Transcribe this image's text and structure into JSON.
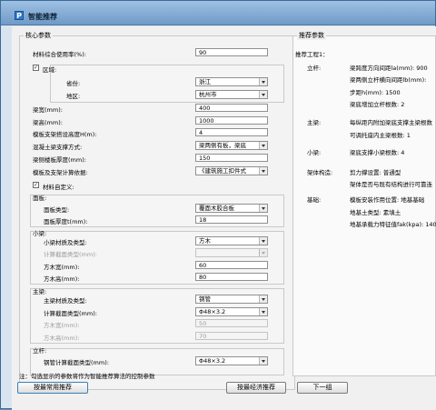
{
  "window": {
    "title": "智能推荐",
    "app_icon": "P"
  },
  "core": {
    "title": "核心参数",
    "material_rate_label": "材料综合使用率(%):",
    "material_rate_value": "90",
    "region_label": "区域:",
    "province_label": "省份:",
    "province_value": "浙江",
    "area_label": "地区:",
    "area_value": "杭州市",
    "beam_width_label": "梁宽(mm):",
    "beam_width_value": "400",
    "beam_height_label": "梁高(mm):",
    "beam_height_value": "1000",
    "support_height_label": "模板支架搭设高度H(m):",
    "support_height_value": "4",
    "concrete_label": "混凝土梁支撑方式:",
    "concrete_value": "梁两侧有板，梁底",
    "slab_label": "梁侧楼板厚度(mm):",
    "slab_value": "150",
    "calc_basis_label": "模板及支架计算依据:",
    "calc_basis_value": "《建筑施工扣件式",
    "custom_label": "材料自定义:"
  },
  "panel": {
    "title": "面板:",
    "type_label": "面板类型:",
    "type_value": "覆面木胶合板",
    "thickness_label": "面板厚度t(mm):",
    "thickness_value": "18"
  },
  "small_beam": {
    "title": "小梁:",
    "material_label": "小梁材质及类型:",
    "material_value": "方木",
    "section_label": "计算截面类型(mm):",
    "section_value": "",
    "width_label": "方木宽(mm):",
    "width_value": "60",
    "height_label": "方木高(mm):",
    "height_value": "80"
  },
  "main_beam": {
    "title": "主梁:",
    "material_label": "主梁材质及类型:",
    "material_value": "钢管",
    "section_label": "计算截面类型(mm):",
    "section_value": "Φ48×3.2",
    "width_label": "方木宽(mm):",
    "width_value": "50",
    "height_label": "方木高(mm):",
    "height_value": "70"
  },
  "pole": {
    "title": "立杆:",
    "section_label": "钢管计算截面类型(mm):",
    "section_value": "Φ48×3.2"
  },
  "note": "注：勾选显示的参数将作为智能推荐算法的控制参数",
  "buttons": {
    "common": "按最常用推荐",
    "economy": "按最经济推荐",
    "next": "下一组"
  },
  "recommend": {
    "title": "推荐参数",
    "scheme": "推荐工程1：",
    "rows": [
      {
        "cat": "立杆:",
        "text": "梁跨度方向间距la(mm): 900"
      },
      {
        "cat": "",
        "text": "梁两侧立杆横向间距lb(mm):"
      },
      {
        "cat": "",
        "text": "步距h(mm): 1500"
      },
      {
        "cat": "",
        "text": "梁底增加立杆根数: 2"
      },
      {
        "cat": "主梁:",
        "text": "每纵距内附加梁底支撑主梁根数"
      },
      {
        "cat": "",
        "text": "可调托座内主梁根数: 1"
      },
      {
        "cat": "小梁:",
        "text": "梁底支撑小梁根数: 4"
      },
      {
        "cat": "架体构造:",
        "text": "剪力撑设置: 普通型"
      },
      {
        "cat": "",
        "text": "架体是否与既有结构进行可靠连"
      },
      {
        "cat": "基础:",
        "text": "模板安装作用位置: 地基基础"
      },
      {
        "cat": "",
        "text": "地基土类型: 素填土"
      },
      {
        "cat": "",
        "text": "地基承载力特征值fak(kpa): 140"
      }
    ]
  },
  "colors": {
    "title_bar": "#7fa7d2",
    "background": "#f0f0f0",
    "accent": "#3c7fb1"
  }
}
